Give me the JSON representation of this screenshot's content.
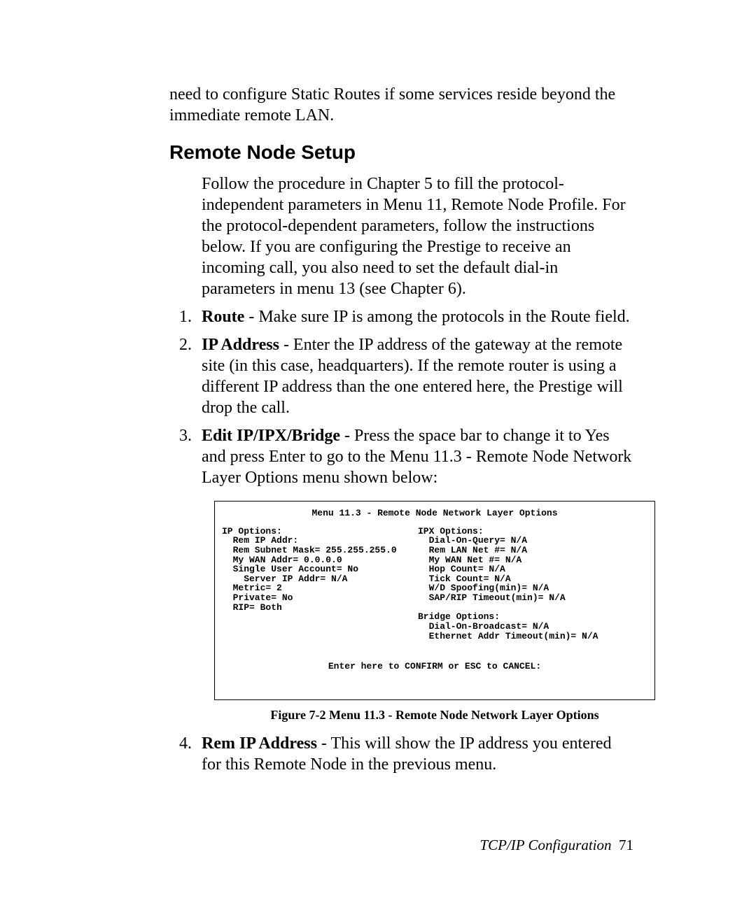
{
  "lead_paragraph": "need to configure Static Routes if some services reside beyond the immediate remote LAN.",
  "section_heading": "Remote Node Setup",
  "intro_paragraph": "Follow the procedure in Chapter 5 to fill the protocol-independent parameters in Menu 11, Remote Node Profile. For the protocol-dependent parameters, follow the instructions below. If you are configuring the Prestige to receive an incoming call, you also need to set the default dial-in parameters in menu 13 (see Chapter 6).",
  "list": [
    {
      "lead": "Route",
      "text": " - Make sure IP is among the protocols in the Route field."
    },
    {
      "lead": "IP Address",
      "text": " - Enter the IP address of the gateway at the remote site (in this case, headquarters). If the remote router is using a different IP address than the one entered here, the Prestige will drop the call."
    },
    {
      "lead": "Edit IP/IPX/Bridge",
      "text": " - Press the space bar to change it to Yes and press Enter to go to the Menu 11.3 - Remote Node Network Layer Options menu shown below:"
    },
    {
      "lead": "Rem IP Address",
      "text": " - This will show the IP address you entered for this Remote Node in the previous menu."
    }
  ],
  "terminal": {
    "title": "Menu 11.3 - Remote Node Network Layer Options",
    "left": {
      "heading": "IP Options:",
      "lines": [
        "  Rem IP Addr:",
        "  Rem Subnet Mask= 255.255.255.0",
        "  My WAN Addr= 0.0.0.0",
        "  Single User Account= No",
        "    Server IP Addr= N/A",
        "  Metric= 2",
        "  Private= No",
        "  RIP= Both"
      ]
    },
    "right": {
      "heading1": "IPX Options:",
      "lines1": [
        "  Dial-On-Query= N/A",
        "  Rem LAN Net #= N/A",
        "  My WAN Net #= N/A",
        "  Hop Count= N/A",
        "  Tick Count= N/A",
        "  W/D Spoofing(min)= N/A",
        "  SAP/RIP Timeout(min)= N/A"
      ],
      "heading2": "Bridge Options:",
      "lines2": [
        "  Dial-On-Broadcast= N/A",
        "  Ethernet Addr Timeout(min)= N/A"
      ]
    },
    "footer": "Enter here to CONFIRM or ESC to CANCEL:"
  },
  "figure_caption": "Figure 7-2 Menu 11.3 - Remote Node Network Layer Options",
  "footer": {
    "title": "TCP/IP Configuration",
    "page": "71"
  }
}
